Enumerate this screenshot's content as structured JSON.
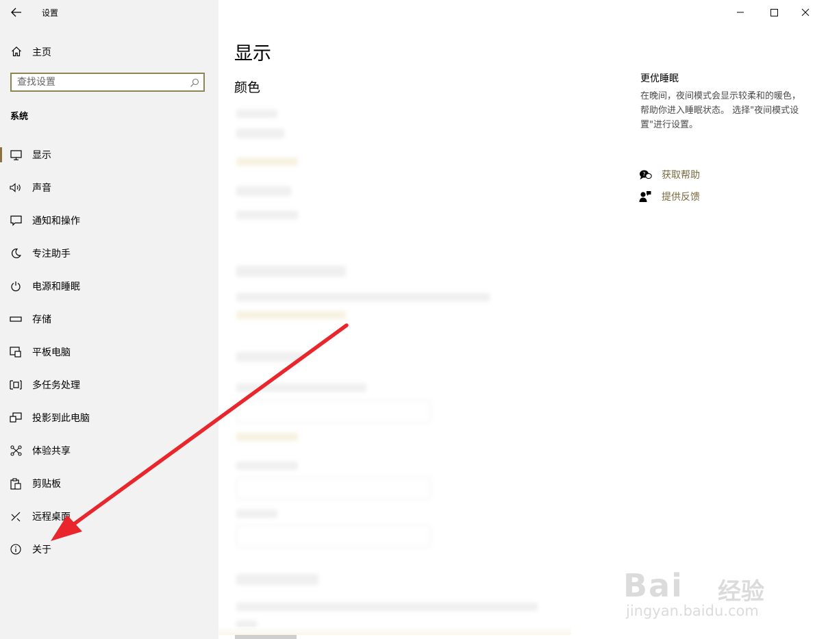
{
  "window": {
    "title": "设置"
  },
  "sidebar": {
    "home_label": "主页",
    "search_placeholder": "查找设置",
    "section_label": "系统",
    "items": [
      {
        "label": "显示",
        "icon": "monitor-icon",
        "active": true
      },
      {
        "label": "声音",
        "icon": "speaker-icon"
      },
      {
        "label": "通知和操作",
        "icon": "notification-icon"
      },
      {
        "label": "专注助手",
        "icon": "moon-icon"
      },
      {
        "label": "电源和睡眠",
        "icon": "power-icon"
      },
      {
        "label": "存储",
        "icon": "storage-icon"
      },
      {
        "label": "平板电脑",
        "icon": "tablet-icon"
      },
      {
        "label": "多任务处理",
        "icon": "multitask-icon"
      },
      {
        "label": "投影到此电脑",
        "icon": "projector-icon"
      },
      {
        "label": "体验共享",
        "icon": "share-icon"
      },
      {
        "label": "剪贴板",
        "icon": "clipboard-icon"
      },
      {
        "label": "远程桌面",
        "icon": "remote-desktop-icon"
      },
      {
        "label": "关于",
        "icon": "info-icon"
      }
    ]
  },
  "main": {
    "title": "显示",
    "subtitle": "颜色"
  },
  "right_panel": {
    "title": "更优睡眠",
    "description": "在晚间，夜间模式会显示较柔和的暖色，帮助你进入睡眠状态。 选择\"夜间模式设置\"进行设置。",
    "links": [
      {
        "label": "获取帮助",
        "icon": "help-chat-icon"
      },
      {
        "label": "提供反馈",
        "icon": "feedback-icon"
      }
    ]
  },
  "watermark": {
    "brand": "Bai",
    "brand_suffix": "经验",
    "url": "jingyan.baidu.com"
  },
  "colors": {
    "accent": "#8a7340",
    "arrow": "#e8262c",
    "sidebar_bg": "#f2f2f2"
  }
}
